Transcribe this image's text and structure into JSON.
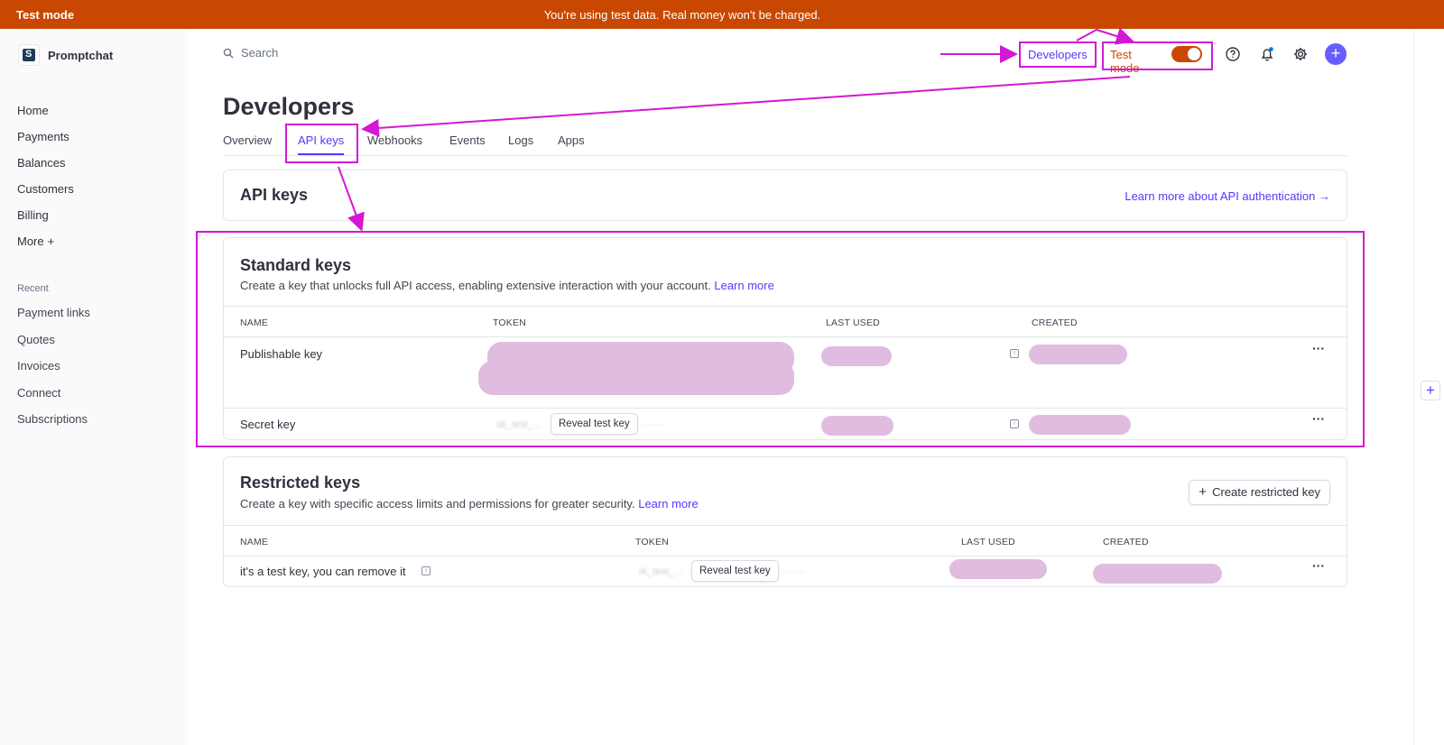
{
  "banner": {
    "label": "Test mode",
    "message": "You're using test data. Real money won't be charged."
  },
  "sidebar": {
    "brand": "Promptchat",
    "items": [
      {
        "label": "Home"
      },
      {
        "label": "Payments"
      },
      {
        "label": "Balances"
      },
      {
        "label": "Customers"
      },
      {
        "label": "Billing"
      },
      {
        "label": "More",
        "suffix": "+"
      }
    ],
    "recent_label": "Recent",
    "recent": [
      {
        "label": "Payment links"
      },
      {
        "label": "Quotes"
      },
      {
        "label": "Invoices"
      },
      {
        "label": "Connect"
      },
      {
        "label": "Subscriptions"
      }
    ]
  },
  "topbar": {
    "search_placeholder": "Search",
    "developers": "Developers",
    "test_mode": "Test mode",
    "test_mode_on": true,
    "add": "+"
  },
  "page": {
    "title": "Developers",
    "tabs": [
      {
        "label": "Overview"
      },
      {
        "label": "API keys",
        "active": true
      },
      {
        "label": "Webhooks"
      },
      {
        "label": "Events"
      },
      {
        "label": "Logs"
      },
      {
        "label": "Apps"
      }
    ]
  },
  "api_keys": {
    "title": "API keys",
    "learn_more": "Learn more about API authentication →"
  },
  "standard_keys": {
    "title": "Standard keys",
    "description": "Create a key that unlocks full API access, enabling extensive interaction with your account.",
    "learn_more": "Learn more",
    "columns": [
      "NAME",
      "TOKEN",
      "LAST USED",
      "CREATED"
    ],
    "rows": [
      {
        "name": "Publishable key"
      },
      {
        "name": "Secret key",
        "token_hint": "sk_test_...",
        "reveal": "Reveal test key"
      }
    ]
  },
  "restricted_keys": {
    "title": "Restricted keys",
    "description": "Create a key with specific access limits and permissions for greater security.",
    "learn_more": "Learn more",
    "create_button": "Create restricted key",
    "columns": [
      "NAME",
      "TOKEN",
      "LAST USED",
      "CREATED"
    ],
    "rows": [
      {
        "name": "it's a test key, you can remove it",
        "token_hint": "rk_test_...",
        "reveal": "Reveal test key"
      }
    ]
  },
  "colors": {
    "banner": "#c84801",
    "accent": "#533afd",
    "annotation": "#d418d4",
    "redaction": "#e0bde0"
  }
}
